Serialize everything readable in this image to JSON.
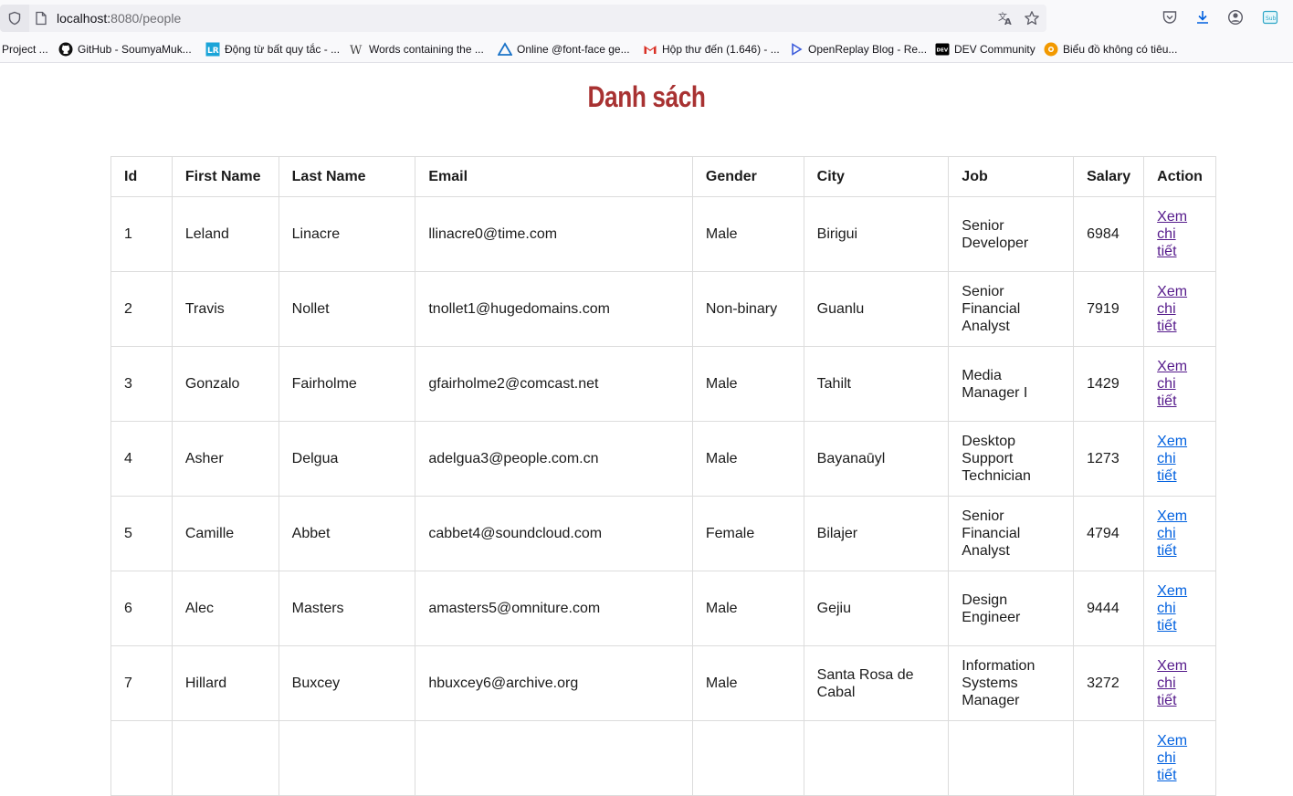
{
  "browser": {
    "url_host": "localhost:",
    "url_rest": "8080/people",
    "bookmarks": [
      {
        "label": "Project ...",
        "icon": "folder-icon"
      },
      {
        "label": "GitHub - SoumyaMuk...",
        "icon": "github-icon"
      },
      {
        "label": "Động từ bất quy tắc - ...",
        "icon": "lr-icon"
      },
      {
        "label": "Words containing the ...",
        "icon": "wikipedia-w-icon"
      },
      {
        "label": "Online @font-face ge...",
        "icon": "triangle-icon"
      },
      {
        "label": "Hộp thư đến (1.646) - ...",
        "icon": "gmail-icon"
      },
      {
        "label": "OpenReplay Blog - Re...",
        "icon": "play-icon"
      },
      {
        "label": "DEV Community",
        "icon": "dev-icon"
      },
      {
        "label": "Biểu đồ không có tiêu...",
        "icon": "chart-icon"
      }
    ]
  },
  "page": {
    "title": "Danh sách"
  },
  "table": {
    "headers": [
      "Id",
      "First Name",
      "Last Name",
      "Email",
      "Gender",
      "City",
      "Job",
      "Salary",
      "Action"
    ],
    "rows": [
      {
        "id": "1",
        "first": "Leland",
        "last": "Linacre",
        "email": "llinacre0@time.com",
        "gender": "Male",
        "city": "Birigui",
        "job": "Senior Developer",
        "salary": "6984",
        "action": "Xem chi tiết"
      },
      {
        "id": "2",
        "first": "Travis",
        "last": "Nollet",
        "email": "tnollet1@hugedomains.com",
        "gender": "Non-binary",
        "city": "Guanlu",
        "job": "Senior Financial Analyst",
        "salary": "7919",
        "action": "Xem chi tiết"
      },
      {
        "id": "3",
        "first": "Gonzalo",
        "last": "Fairholme",
        "email": "gfairholme2@comcast.net",
        "gender": "Male",
        "city": "Tahilt",
        "job": "Media Manager I",
        "salary": "1429",
        "action": "Xem chi tiết"
      },
      {
        "id": "4",
        "first": "Asher",
        "last": "Delgua",
        "email": "adelgua3@people.com.cn",
        "gender": "Male",
        "city": "Bayanaūyl",
        "job": "Desktop Support Technician",
        "salary": "1273",
        "action": "Xem chi tiết"
      },
      {
        "id": "5",
        "first": "Camille",
        "last": "Abbet",
        "email": "cabbet4@soundcloud.com",
        "gender": "Female",
        "city": "Bilajer",
        "job": "Senior Financial Analyst",
        "salary": "4794",
        "action": "Xem chi tiết"
      },
      {
        "id": "6",
        "first": "Alec",
        "last": "Masters",
        "email": "amasters5@omniture.com",
        "gender": "Male",
        "city": "Gejiu",
        "job": "Design Engineer",
        "salary": "9444",
        "action": "Xem chi tiết"
      },
      {
        "id": "7",
        "first": "Hillard",
        "last": "Buxcey",
        "email": "hbuxcey6@archive.org",
        "gender": "Male",
        "city": "Santa Rosa de Cabal",
        "job": "Information Systems Manager",
        "salary": "3272",
        "action": "Xem chi tiết"
      },
      {
        "id": "",
        "first": "",
        "last": "",
        "email": "",
        "gender": "",
        "city": "",
        "job": "",
        "salary": "",
        "action": "Xem chi tiết"
      }
    ],
    "visited_rows": [
      0,
      1,
      2,
      6
    ]
  }
}
